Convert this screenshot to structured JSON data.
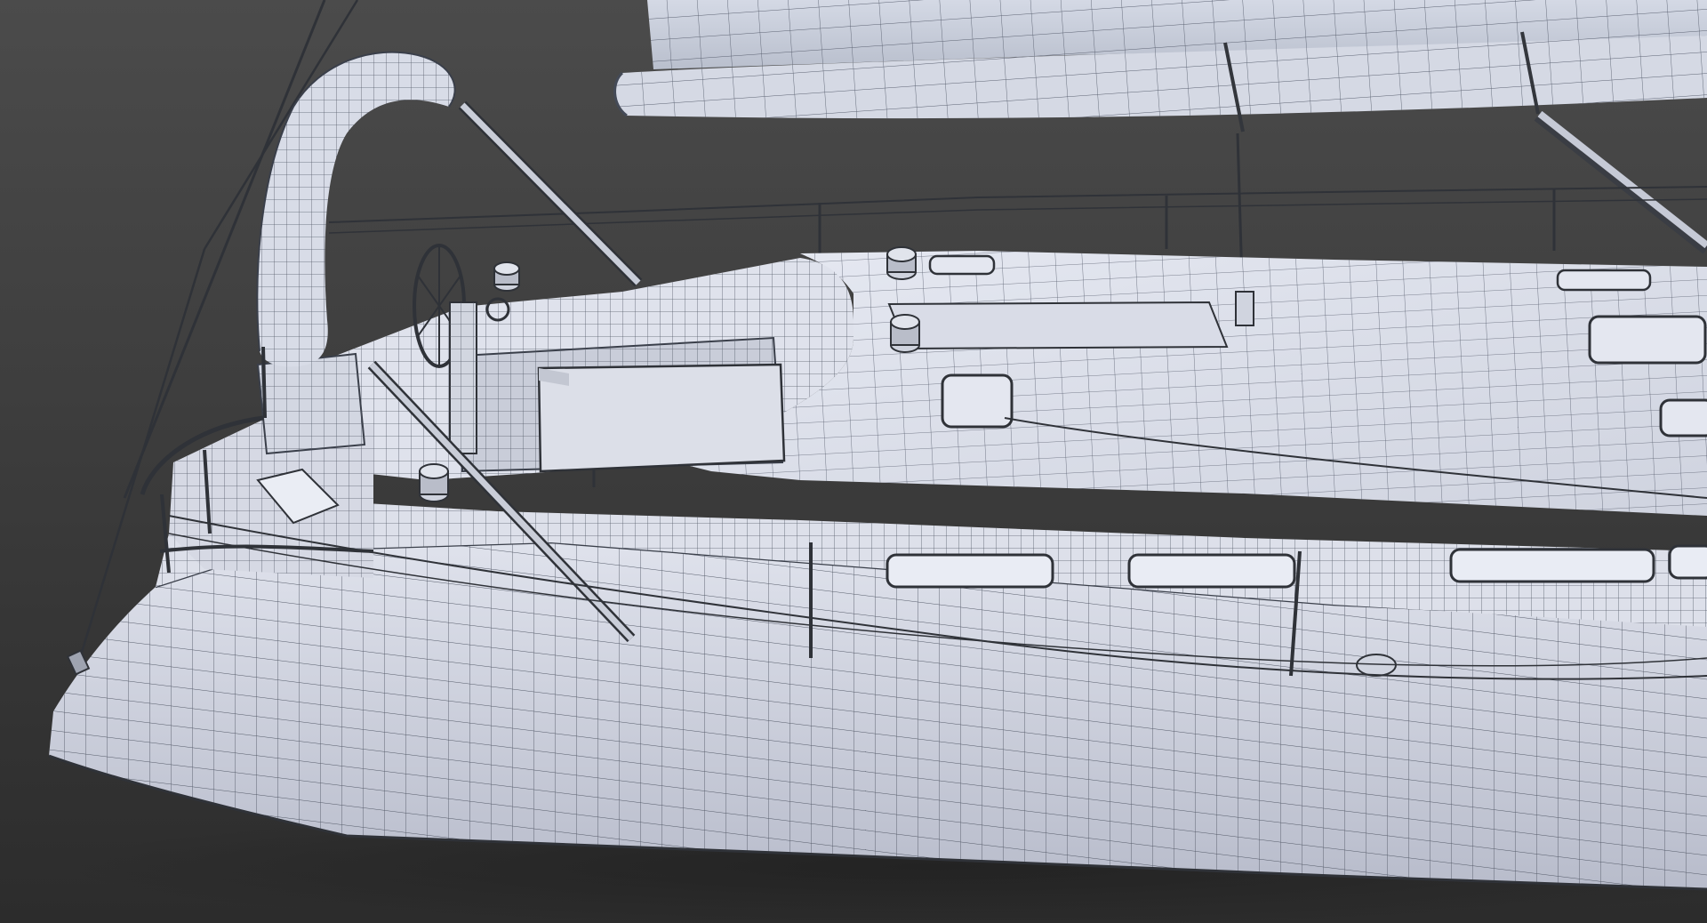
{
  "scene": {
    "subject": "sailboat-wireframe-render",
    "colors": {
      "background_top": "#4a4a4a",
      "background_bottom": "#2e2e2e",
      "hull": "#d8dbe6",
      "hull_shadow": "#b6bac8",
      "deck": "#dfe2ec",
      "wire": "#444a57",
      "rigging": "#3c3f46",
      "sail": "#c9cfdc"
    }
  }
}
